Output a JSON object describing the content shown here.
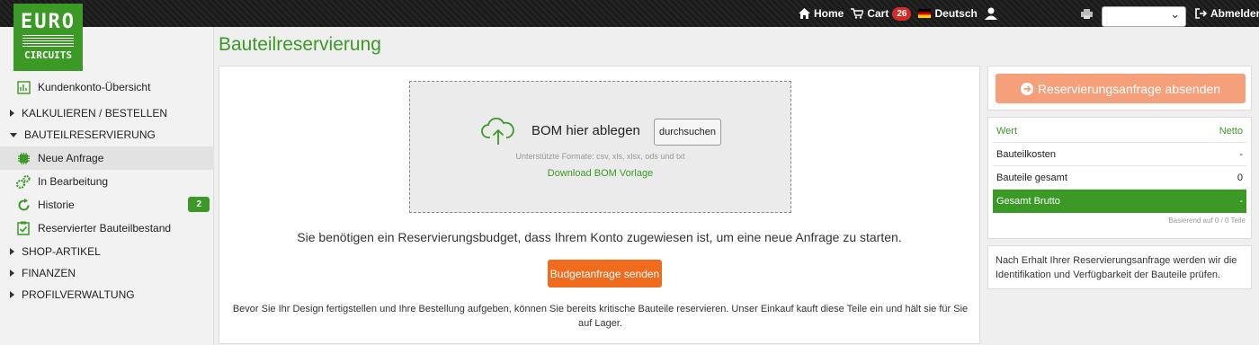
{
  "logo": {
    "line1": "EURO",
    "line2": "CIRCUITS"
  },
  "topnav": {
    "home": "Home",
    "cart": "Cart",
    "cart_count": "26",
    "language": "Deutsch",
    "logout": "Abmelden"
  },
  "sidebar": {
    "account_overview": "Kundenkonto-Übersicht",
    "sections": [
      {
        "label": "KALKULIEREN / BESTELLEN"
      },
      {
        "label": "BAUTEILRESERVIERUNG"
      },
      {
        "label": "SHOP-ARTIKEL"
      },
      {
        "label": "FINANZEN"
      },
      {
        "label": "PROFILVERWALTUNG"
      }
    ],
    "items": [
      {
        "label": "Neue Anfrage"
      },
      {
        "label": "In Bearbeitung"
      },
      {
        "label": "Historie",
        "badge": "2"
      },
      {
        "label": "Reservierter Bauteilbestand"
      }
    ]
  },
  "page": {
    "title": "Bauteilreservierung"
  },
  "upload": {
    "drop_label": "BOM hier ablegen",
    "browse": "durchsuchen",
    "formats": "Unterstützte Formate: csv, xls, xlsx, ods und txt",
    "template_link": "Download BOM Vorlage"
  },
  "main": {
    "budget_message": "Sie benötigen ein Reservierungsbudget, dass Ihrem Konto zugewiesen ist, um eine neue Anfrage zu starten.",
    "budget_button": "Budgetanfrage senden",
    "footer_text": "Bevor Sie Ihr Design fertigstellen und Ihre Bestellung aufgeben, können Sie bereits kritische Bauteile reservieren. Unser Einkauf kauft diese Teile ein und hält sie für Sie auf Lager."
  },
  "summary": {
    "submit": "Reservierungsanfrage absenden",
    "head_left": "Wert",
    "head_right": "Netto",
    "rows": [
      {
        "label": "Bauteilkosten",
        "value": "-"
      },
      {
        "label": "Bauteile gesamt",
        "value": "0"
      }
    ],
    "total_label": "Gesamt Brutto",
    "total_value": "-",
    "based_on": "Basierend auf 0 / 0 Teile"
  },
  "info": {
    "text": "Nach Erhalt Ihrer Reservierungsanfrage werden wir die Identifikation und Verfügbarkeit der Bauteile prüfen."
  },
  "colors": {
    "brand_green": "#3b9a25",
    "accent_orange": "#ef6c1f"
  }
}
